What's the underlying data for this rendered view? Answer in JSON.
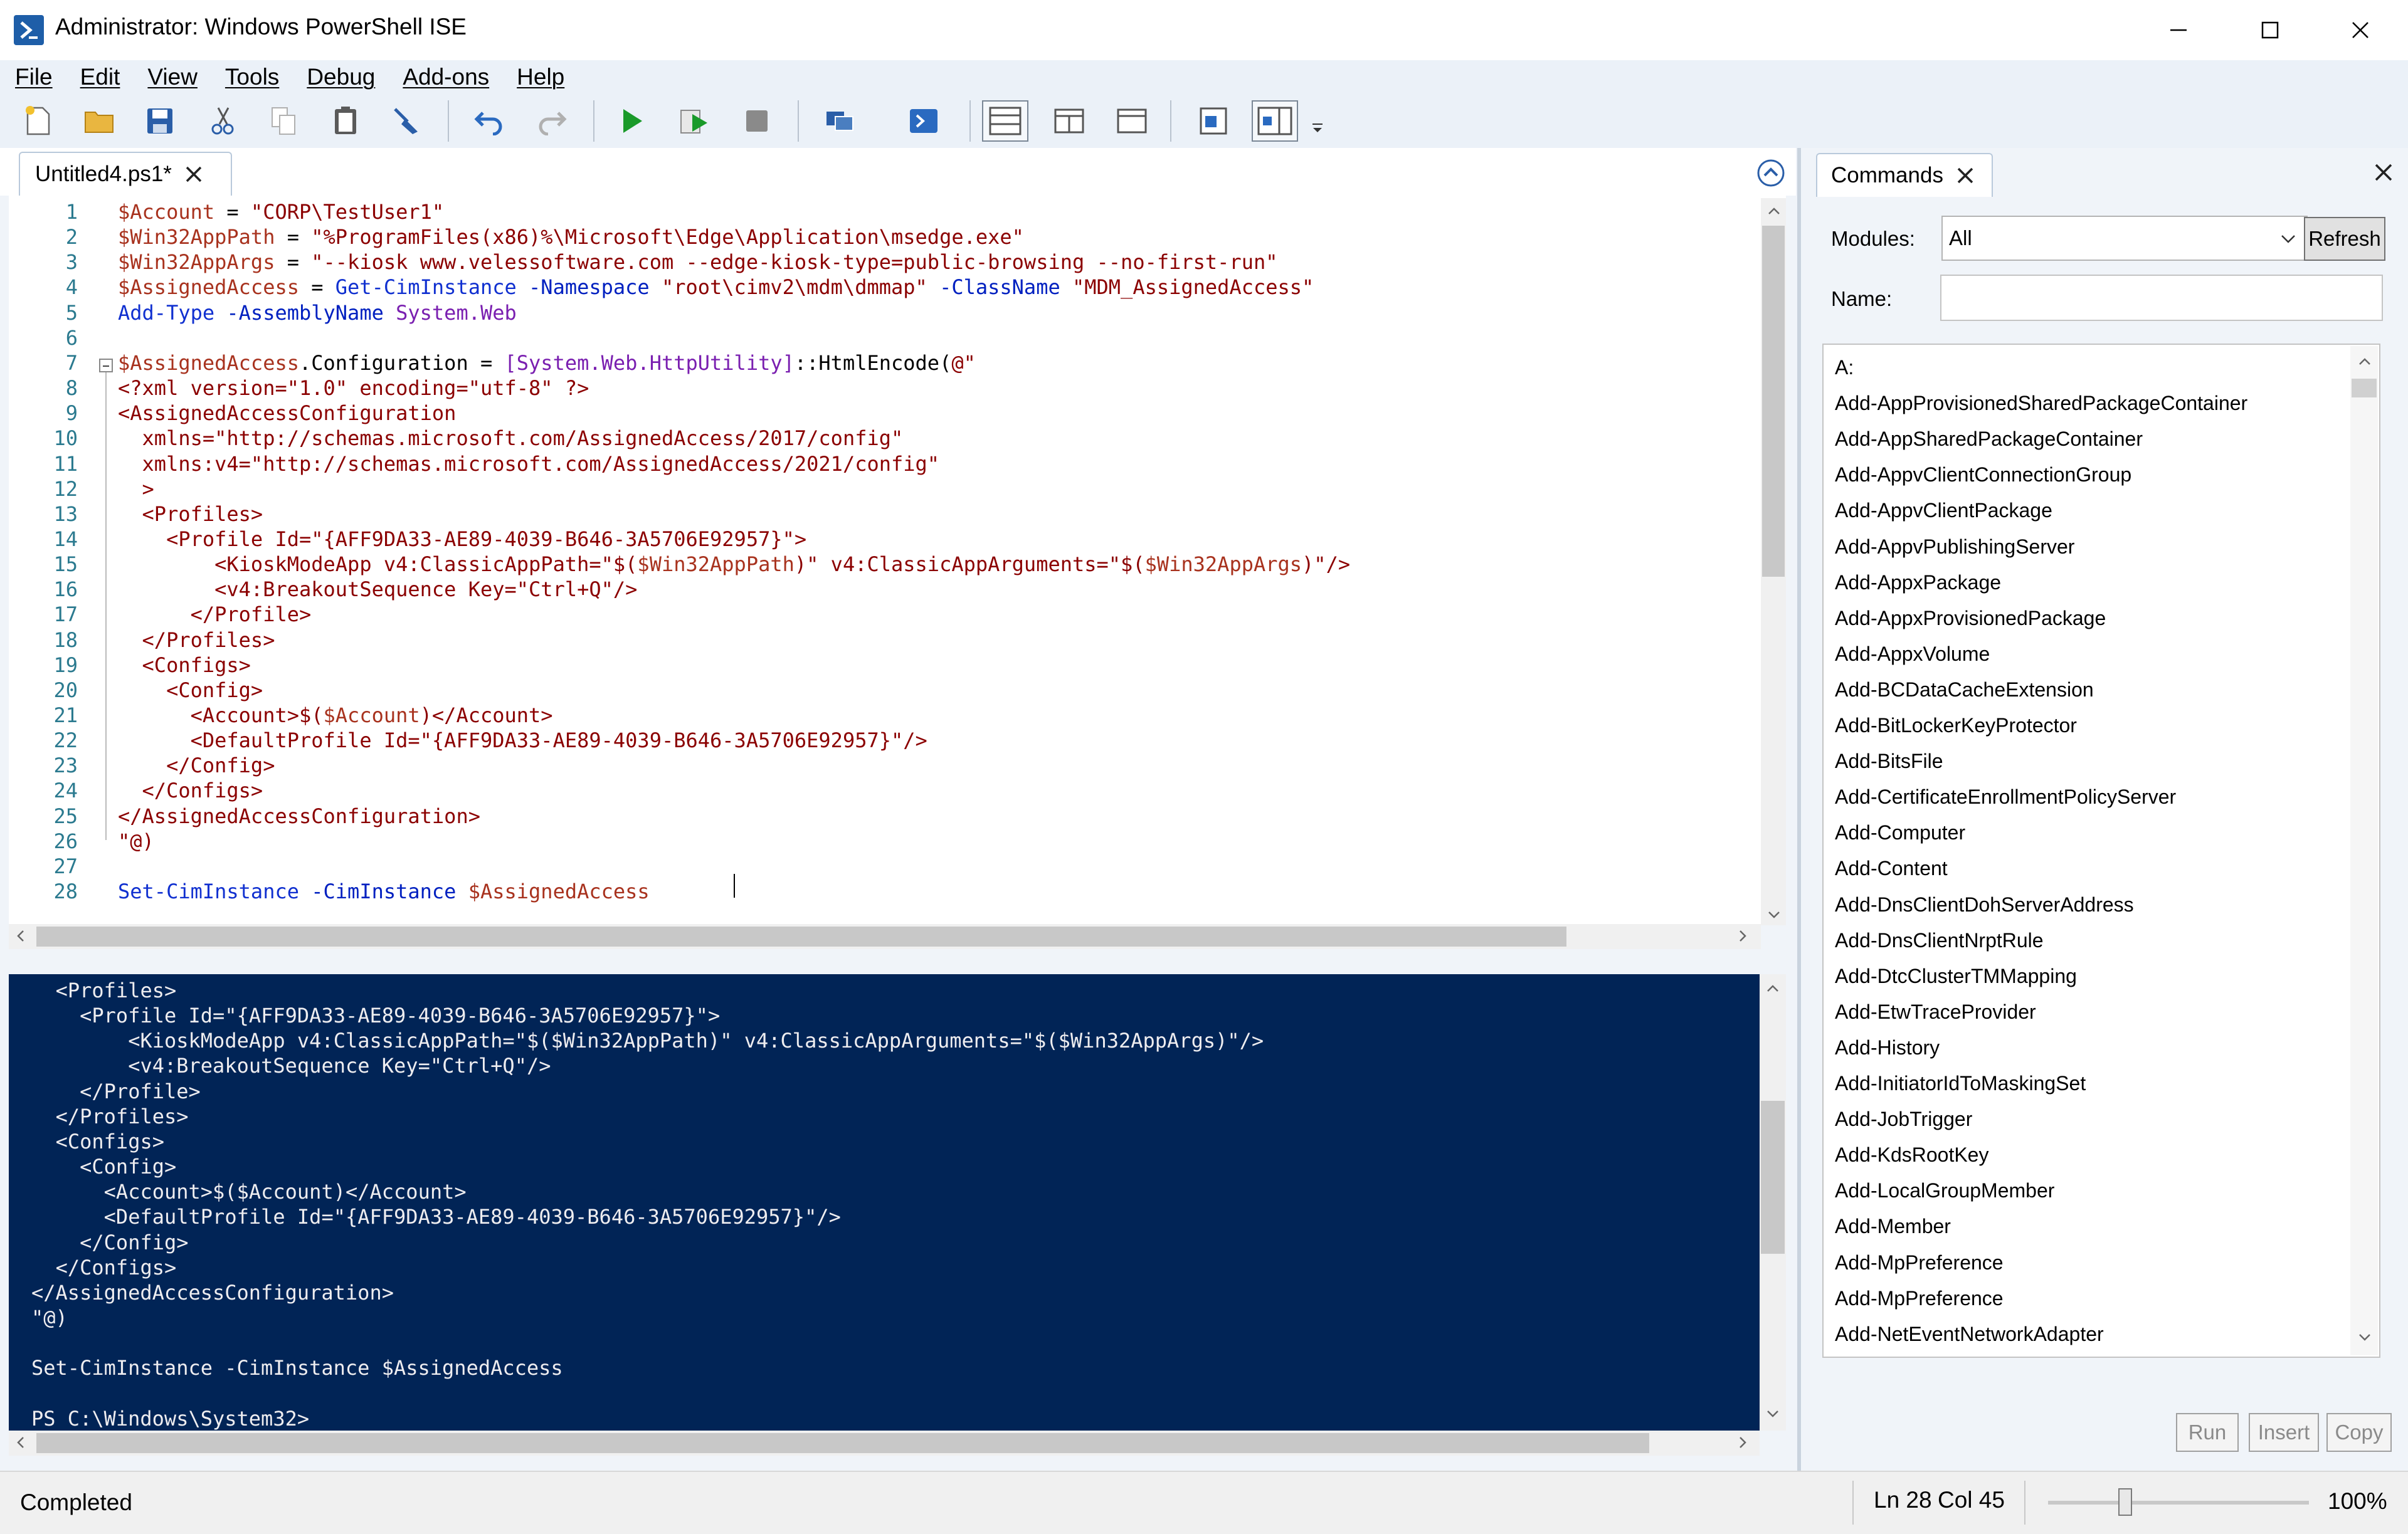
{
  "window": {
    "title": "Administrator: Windows PowerShell ISE",
    "controls": [
      "minimize",
      "maximize",
      "close"
    ]
  },
  "menu": [
    "File",
    "Edit",
    "View",
    "Tools",
    "Debug",
    "Add-ons",
    "Help"
  ],
  "toolbar": [
    "new-script",
    "open",
    "save",
    "cut",
    "copy",
    "paste",
    "clear-console",
    "undo",
    "redo",
    "run-script",
    "run-selection",
    "stop",
    "new-remote-tab",
    "start-powershell",
    "show-script-pane-top",
    "show-script-pane-right",
    "show-script-pane-max",
    "show-command-window",
    "show-command-addon",
    "toolbar-overflow"
  ],
  "editor": {
    "tab_label": "Untitled4.ps1*",
    "line_numbers": [
      "1",
      "2",
      "3",
      "4",
      "5",
      "6",
      "7",
      "8",
      "9",
      "10",
      "11",
      "12",
      "13",
      "14",
      "15",
      "16",
      "17",
      "18",
      "19",
      "20",
      "21",
      "22",
      "23",
      "24",
      "25",
      "26",
      "27",
      "28"
    ],
    "lines": {
      "l1": [
        "$Account",
        " = ",
        "\"CORP\\TestUser1\""
      ],
      "l2": [
        "$Win32AppPath",
        " = ",
        "\"%ProgramFiles(x86)%\\Microsoft\\Edge\\Application\\msedge.exe\""
      ],
      "l3": [
        "$Win32AppArgs",
        " = ",
        "\"--kiosk www.velessoftware.com --edge-kiosk-type=public-browsing --no-first-run\""
      ],
      "l4": [
        "$AssignedAccess",
        " = ",
        "Get-CimInstance",
        " -Namespace ",
        "\"root\\cimv2\\mdm\\dmmap\"",
        " -ClassName ",
        "\"MDM_AssignedAccess\""
      ],
      "l5": [
        "Add-Type",
        " -AssemblyName ",
        "System.Web"
      ],
      "l7": [
        "$AssignedAccess",
        ".Configuration = ",
        "[System.Web.HttpUtility]",
        "::HtmlEncode(",
        "@\""
      ],
      "l8": "<?xml version=\"1.0\" encoding=\"utf-8\" ?>",
      "l9": "<AssignedAccessConfiguration",
      "l10": "  xmlns=\"http://schemas.microsoft.com/AssignedAccess/2017/config\"",
      "l11": "  xmlns:v4=\"http://schemas.microsoft.com/AssignedAccess/2021/config\"",
      "l12": "  >",
      "l13": "  <Profiles>",
      "l14": "    <Profile Id=\"{AFF9DA33-AE89-4039-B646-3A5706E92957}\">",
      "l15": [
        "        <KioskModeApp v4:ClassicAppPath=\"$(",
        "$Win32AppPath",
        ")\" v4:ClassicAppArguments=\"$(",
        "$Win32AppArgs",
        ")\"/>"
      ],
      "l16": "        <v4:BreakoutSequence Key=\"Ctrl+Q\"/>",
      "l17": "      </Profile>",
      "l18": "  </Profiles>",
      "l19": "  <Configs>",
      "l20": "    <Config>",
      "l21": [
        "      <Account>$(",
        "$Account",
        ")</Account>"
      ],
      "l22": "      <DefaultProfile Id=\"{AFF9DA33-AE89-4039-B646-3A5706E92957}\"/>",
      "l23": "    </Config>",
      "l24": "  </Configs>",
      "l25": "</AssignedAccessConfiguration>",
      "l26": "\"@)",
      "l28": [
        "Set-CimInstance",
        " -CimInstance ",
        "$AssignedAccess"
      ]
    }
  },
  "console": {
    "lines": [
      "<Profiles>",
      "  <Profile Id=\"{AFF9DA33-AE89-4039-B646-3A5706E92957}\">",
      "      <KioskModeApp v4:ClassicAppPath=\"$($Win32AppPath)\" v4:ClassicAppArguments=\"$($Win32AppArgs)\"/>",
      "      <v4:BreakoutSequence Key=\"Ctrl+Q\"/>",
      "  </Profile>",
      "</Profiles>",
      "<Configs>",
      "  <Config>",
      "    <Account>$($Account)</Account>",
      "    <DefaultProfile Id=\"{AFF9DA33-AE89-4039-B646-3A5706E92957}\"/>",
      "  </Config>",
      "</Configs>",
      "</AssignedAccessConfiguration>",
      "\"@)",
      "",
      "Set-CimInstance -CimInstance $AssignedAccess",
      "",
      "PS C:\\Windows\\System32>"
    ]
  },
  "commands": {
    "tab_label": "Commands",
    "modules_label": "Modules:",
    "modules_value": "All",
    "refresh_label": "Refresh",
    "name_label": "Name:",
    "name_value": "",
    "items": [
      "A:",
      "Add-AppProvisionedSharedPackageContainer",
      "Add-AppSharedPackageContainer",
      "Add-AppvClientConnectionGroup",
      "Add-AppvClientPackage",
      "Add-AppvPublishingServer",
      "Add-AppxPackage",
      "Add-AppxProvisionedPackage",
      "Add-AppxVolume",
      "Add-BCDataCacheExtension",
      "Add-BitLockerKeyProtector",
      "Add-BitsFile",
      "Add-CertificateEnrollmentPolicyServer",
      "Add-Computer",
      "Add-Content",
      "Add-DnsClientDohServerAddress",
      "Add-DnsClientNrptRule",
      "Add-DtcClusterTMMapping",
      "Add-EtwTraceProvider",
      "Add-History",
      "Add-InitiatorIdToMaskingSet",
      "Add-JobTrigger",
      "Add-KdsRootKey",
      "Add-LocalGroupMember",
      "Add-Member",
      "Add-MpPreference",
      "Add-MpPreference",
      "Add-NetEventNetworkAdapter"
    ],
    "run_label": "Run",
    "insert_label": "Insert",
    "copy_label": "Copy"
  },
  "status": {
    "state": "Completed",
    "line": "Ln 28",
    "col": "Col 45",
    "zoom": "100%",
    "zoom_percent": 100
  },
  "colors": {
    "console_bg": "#012456",
    "variable": "#a8321e",
    "string": "#8b0000",
    "command": "#1030d0",
    "type": "#7a1fb0"
  }
}
